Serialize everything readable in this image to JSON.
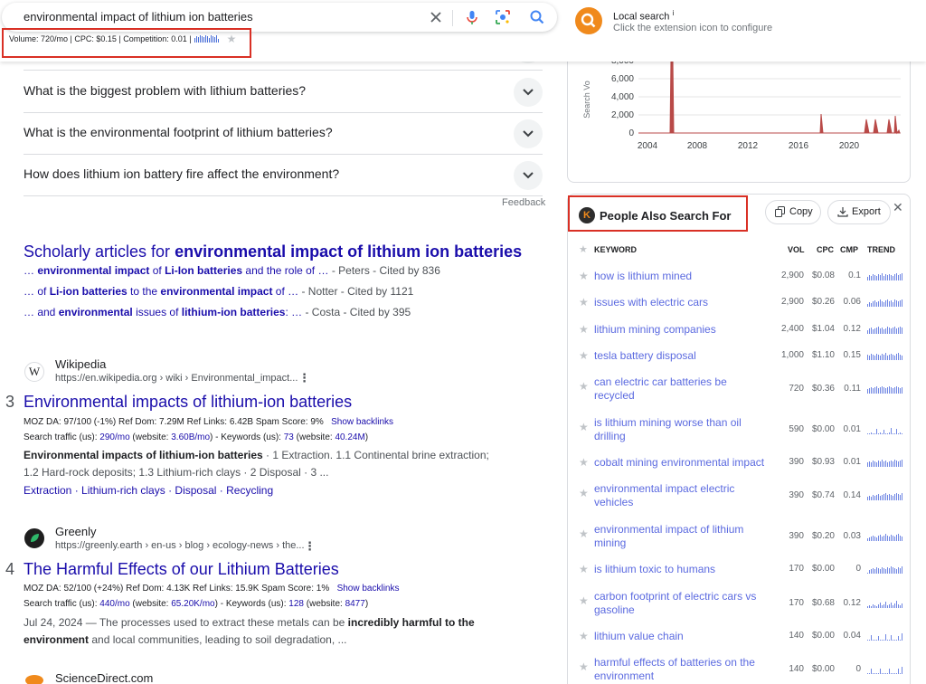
{
  "search": {
    "query": "environmental impact of lithium ion batteries",
    "volume_line": "Volume: 720/mo | CPC: $0.15 | Competition: 0.01 |"
  },
  "extension": {
    "title": "Local search",
    "info_glyph": "i",
    "subtitle": "Click the extension icon to configure"
  },
  "faq": [
    "What is the biggest problem with lithium batteries?",
    "What is the environmental footprint of lithium batteries?",
    "How does lithium ion battery fire affect the environment?"
  ],
  "feedback_label": "Feedback",
  "scholarly": {
    "title_prefix": "Scholarly articles for ",
    "title_bold": "environmental impact of lithium ion batteries",
    "items": [
      {
        "pre": "… ",
        "b1": "environmental impact",
        "m1": " of ",
        "b2": "Li-Ion batteries",
        "m2": " and the role of … ",
        "src": "- Peters - Cited by 836"
      },
      {
        "pre": "… of ",
        "b1": "Li-ion batteries",
        "m1": " to the ",
        "b2": "environmental impact",
        "m2": " of … ",
        "src": "- Notter - Cited by 1121"
      },
      {
        "pre": "… and ",
        "b1": "environmental",
        "m1": " issues of ",
        "b2": "lithium-ion batteries",
        "m2": ": … ",
        "src": "- Costa - Cited by 395"
      }
    ]
  },
  "results": [
    {
      "rank": "3",
      "site": "Wikipedia",
      "icon_letter": "W",
      "url": "https://en.wikipedia.org › wiki › Environmental_impact...",
      "title": "Environmental impacts of lithium-ion batteries",
      "moz": "MOZ DA: 97/100 (-1%)   Ref Dom: 7.29M   Ref Links: 6.42B   Spam Score: 9%",
      "backlinks": "Show backlinks",
      "traffic_pre": "Search traffic (us): ",
      "traffic": "290/mo",
      "website_pre": " (website: ",
      "website": "3.60B/mo",
      "kw_pre": ") - Keywords (us): ",
      "kw": "73",
      "kw_web_pre": " (website: ",
      "kw_web": "40.24M",
      "close": ")",
      "snippet_bold": "Environmental impacts of lithium-ion batteries",
      "snippet_rest": " · 1 Extraction. 1.1 Continental brine extraction;",
      "snippet_line2": "1.2 Hard-rock deposits; 1.3 Lithium-rich clays · 2 Disposal · 3 ...",
      "sublinks": [
        "Extraction",
        "Lithium-rich clays",
        "Disposal",
        "Recycling"
      ]
    },
    {
      "rank": "4",
      "site": "Greenly",
      "url": "https://greenly.earth › en-us › blog › ecology-news › the...",
      "title": "The Harmful Effects of our Lithium Batteries",
      "moz": "MOZ DA: 52/100 (+24%)   Ref Dom: 4.13K   Ref Links: 15.9K   Spam Score: 1%",
      "backlinks": "Show backlinks",
      "traffic_pre": "Search traffic (us): ",
      "traffic": "440/mo",
      "website_pre": " (website: ",
      "website": "65.20K/mo",
      "kw_pre": ") - Keywords (us): ",
      "kw": "128",
      "kw_web_pre": " (website: ",
      "kw_web": "8477",
      "close": ")",
      "date": "Jul 24, 2024",
      "snippet_mid": " — The processes used to extract these metals can be ",
      "snippet_bold": "incredibly harmful to the",
      "snippet_bold2": "environment",
      "snippet_end": " and local communities, leading to soil degradation, ..."
    }
  ],
  "next_site": "ScienceDirect.com",
  "trend_chart": {
    "y_label": "Search Vo",
    "y_ticks": [
      "8,000",
      "6,000",
      "4,000",
      "2,000",
      "0"
    ],
    "x_ticks": [
      "2004",
      "2008",
      "2012",
      "2016",
      "2020"
    ],
    "color": "#b94a48"
  },
  "pas": {
    "title": "People Also Search For",
    "logo_letter": "K",
    "copy_label": "Copy",
    "export_label": "Export",
    "close_glyph": "✕",
    "headers": {
      "keyword": "KEYWORD",
      "vol": "VOL",
      "cpc": "CPC",
      "cmp": "CMP",
      "trend": "TREND"
    },
    "rows": [
      {
        "l1": "how is lithium mined",
        "l2": "",
        "vol": "2,900",
        "cpc": "$0.08",
        "cmp": "0.1"
      },
      {
        "l1": "issues with electric cars",
        "l2": "",
        "vol": "2,900",
        "cpc": "$0.26",
        "cmp": "0.06"
      },
      {
        "l1": "lithium mining companies",
        "l2": "",
        "vol": "2,400",
        "cpc": "$1.04",
        "cmp": "0.12"
      },
      {
        "l1": "tesla battery disposal",
        "l2": "",
        "vol": "1,000",
        "cpc": "$1.10",
        "cmp": "0.15"
      },
      {
        "l1": "can electric car batteries be",
        "l2": "recycled",
        "vol": "720",
        "cpc": "$0.36",
        "cmp": "0.11"
      },
      {
        "l1": "is lithium mining worse than oil",
        "l2": "drilling",
        "vol": "590",
        "cpc": "$0.00",
        "cmp": "0.01"
      },
      {
        "l1": "cobalt mining environmental impact",
        "l2": "",
        "vol": "390",
        "cpc": "$0.93",
        "cmp": "0.01"
      },
      {
        "l1": "environmental impact electric",
        "l2": "vehicles",
        "vol": "390",
        "cpc": "$0.74",
        "cmp": "0.14"
      },
      {
        "l1": "environmental impact of lithium",
        "l2": "mining",
        "vol": "390",
        "cpc": "$0.20",
        "cmp": "0.03"
      },
      {
        "l1": "is lithium toxic to humans",
        "l2": "",
        "vol": "170",
        "cpc": "$0.00",
        "cmp": "0"
      },
      {
        "l1": "carbon footprint of electric cars vs",
        "l2": "gasoline",
        "vol": "170",
        "cpc": "$0.68",
        "cmp": "0.12"
      },
      {
        "l1": "lithium value chain",
        "l2": "",
        "vol": "140",
        "cpc": "$0.00",
        "cmp": "0.04"
      },
      {
        "l1": "harmful effects of batteries on the",
        "l2": "environment",
        "vol": "140",
        "cpc": "$0.00",
        "cmp": "0"
      }
    ]
  },
  "colors": {
    "link": "#1a0dab",
    "keyword": "#5b6ae0",
    "highlight": "#d93025",
    "accent": "#f08a1c"
  }
}
